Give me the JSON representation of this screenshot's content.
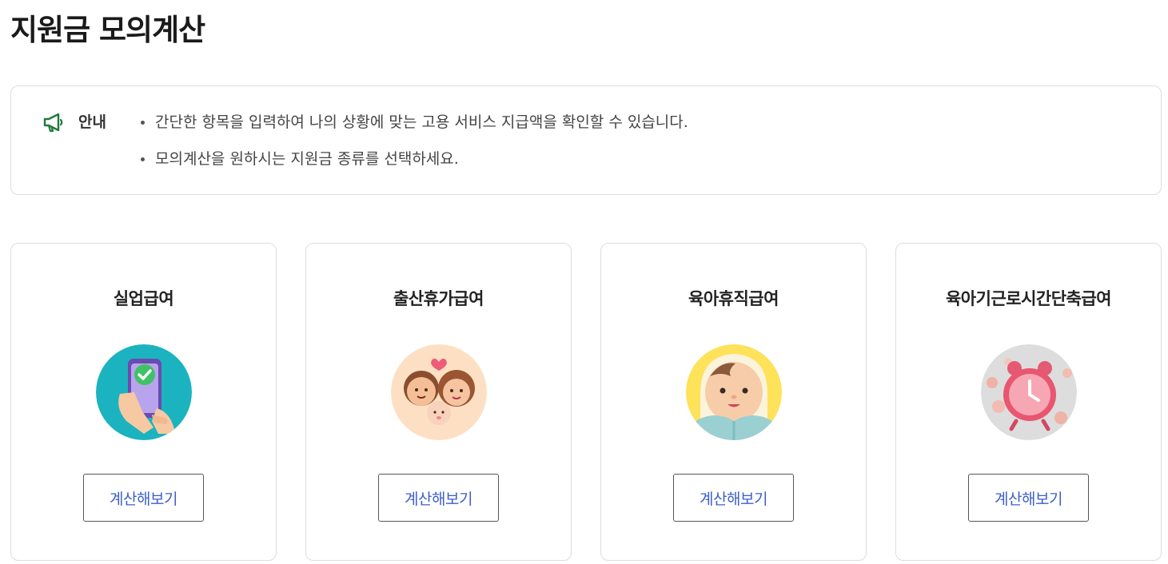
{
  "page": {
    "title": "지원금 모의계산"
  },
  "notice": {
    "icon": "megaphone-icon",
    "label": "안내",
    "items": [
      "간단한 항목을 입력하여 나의 상황에 맞는 고용 서비스 지급액을 확인할 수 있습니다.",
      "모의계산을 원하시는 지원금 종류를 선택하세요."
    ],
    "accent_color": "#1f7a3f"
  },
  "cards": [
    {
      "title": "실업급여",
      "illustration": "phone-checkmark-icon",
      "button_label": "계산해보기",
      "bg_color": "#1bb3c0"
    },
    {
      "title": "출산휴가급여",
      "illustration": "family-baby-icon",
      "button_label": "계산해보기",
      "bg_color": "#fde0c4"
    },
    {
      "title": "육아휴직급여",
      "illustration": "swaddled-baby-icon",
      "button_label": "계산해보기",
      "bg_color": "#fde25a"
    },
    {
      "title": "육아기근로시간단축급여",
      "illustration": "alarm-clock-coins-icon",
      "button_label": "계산해보기",
      "bg_color": "#dddddd"
    }
  ],
  "colors": {
    "button_text": "#3d5fc8",
    "border": "#dddddd"
  }
}
